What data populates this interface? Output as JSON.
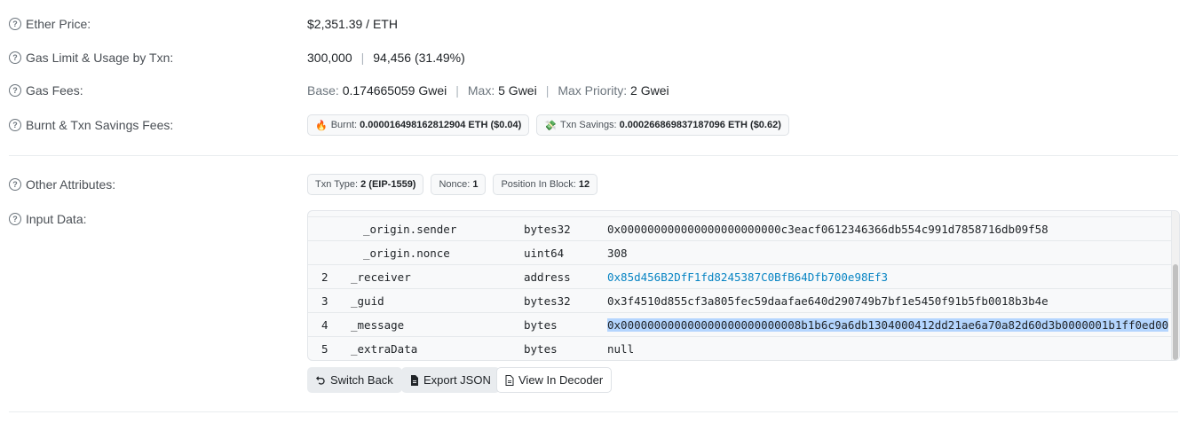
{
  "ether_price": {
    "label": "Ether Price:",
    "value": "$2,351.39 / ETH"
  },
  "gas_limit": {
    "label": "Gas Limit & Usage by Txn:",
    "limit": "300,000",
    "separator": "|",
    "usage": "94,456 (31.49%)"
  },
  "gas_fees": {
    "label": "Gas Fees:",
    "base_label": "Base:",
    "base_value": "0.174665059 Gwei",
    "max_label": "Max:",
    "max_value": "5 Gwei",
    "priority_label": "Max Priority:",
    "priority_value": "2 Gwei"
  },
  "burnt_savings": {
    "label": "Burnt & Txn Savings Fees:",
    "burnt_icon": "🔥",
    "burnt_label": "Burnt:",
    "burnt_value": "0.000016498162812904 ETH ($0.04)",
    "savings_icon": "💸",
    "savings_label": "Txn Savings:",
    "savings_value": "0.000266869837187096 ETH ($0.62)"
  },
  "other_attributes": {
    "label": "Other Attributes:",
    "txn_type_label": "Txn Type:",
    "txn_type_value": "2 (EIP-1559)",
    "nonce_label": "Nonce:",
    "nonce_value": "1",
    "position_label": "Position In Block:",
    "position_value": "12"
  },
  "input_data": {
    "label": "Input Data:",
    "rows": [
      {
        "num": "",
        "name": "_origin.sender",
        "type": "bytes32",
        "value": "0x000000000000000000000000c3eacf0612346366db554c991d7858716db09f58"
      },
      {
        "num": "",
        "name": "_origin.nonce",
        "type": "uint64",
        "value": "308"
      },
      {
        "num": "2",
        "name": "_receiver",
        "type": "address",
        "value": "0x85d456B2DfF1fd8245387C0BfB64Dfb700e98Ef3"
      },
      {
        "num": "3",
        "name": "_guid",
        "type": "bytes32",
        "value": "0x3f4510d855cf3a805fec59daafae640d290749b7bf1e5450f91b5fb0018b3b4e"
      },
      {
        "num": "4",
        "name": "_message",
        "type": "bytes",
        "value": "0x000000000000000000000000008b1b6c9a6db1304000412dd21ae6a70a82d60d3b0000001b1ff0ed00"
      },
      {
        "num": "5",
        "name": "_extraData",
        "type": "bytes",
        "value": "null"
      }
    ],
    "buttons": {
      "switch_back": "Switch Back",
      "export_json": "Export JSON",
      "view_decoder": "View In Decoder"
    }
  },
  "icons": [
    "question-circle-icon",
    "fire-icon",
    "money-wings-icon",
    "undo-icon",
    "file-icon",
    "document-icon"
  ],
  "colors": {
    "link": "#0784c3",
    "highlight": "#b4d5fe",
    "label": "#4a4f55"
  }
}
